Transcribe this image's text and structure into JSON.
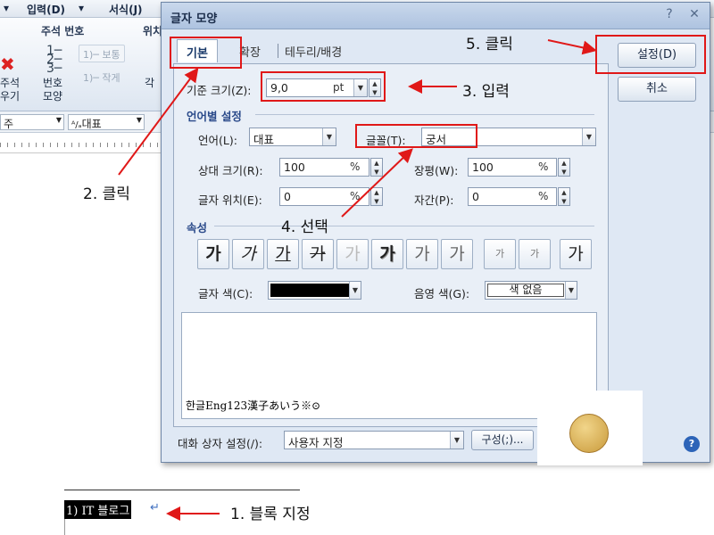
{
  "menu": {
    "input": "입력(D)",
    "format": "서식(J)"
  },
  "ribbon": {
    "group_annotation": "주석 번호",
    "group_position": "위치",
    "btn_normal": "1)─ 보통",
    "btn_small": "1)─ 작게",
    "label_number_shape_1": "번호",
    "label_number_shape_2": "모양",
    "label_delete_1": "주석",
    "label_delete_2": "우기",
    "label_each": "각"
  },
  "format_bar": {
    "style_value": "주",
    "font_value": "대표"
  },
  "document": {
    "text": "1) IT 블로그"
  },
  "annotations": {
    "step1": "1. 블록 지정",
    "step2": "2. 클릭",
    "step3": "3. 입력",
    "step4": "4. 선택",
    "step5": "5. 클릭"
  },
  "dialog": {
    "title": "글자 모양",
    "help": "?",
    "close": "✕",
    "tabs": [
      "기본",
      "확장",
      "테두리/배경"
    ],
    "base_size_label": "기준 크기(Z):",
    "base_size_value": "9,0",
    "base_size_unit": "pt",
    "lang_section": "언어별 설정",
    "language_label": "언어(L):",
    "language_value": "대표",
    "font_label": "글꼴(T):",
    "font_value": "궁서",
    "rel_size_label": "상대 크기(R):",
    "rel_size_value": "100",
    "rel_size_unit": "%",
    "width_label": "장평(W):",
    "width_value": "100",
    "width_unit": "%",
    "position_label": "글자 위치(E):",
    "position_value": "0",
    "position_unit": "%",
    "spacing_label": "자간(P):",
    "spacing_value": "0",
    "spacing_unit": "%",
    "attr_section": "속성",
    "attr_buttons": [
      "가",
      "가",
      "가",
      "가",
      "가",
      "가",
      "가",
      "가",
      "가",
      "가",
      "가"
    ],
    "color_label": "글자 색(C):",
    "color_value": "#000000",
    "shade_label": "음영 색(G):",
    "shade_value": "색 없음",
    "preview_text": "한글Eng123漢子あいう※⊙",
    "dialog_setting_label": "대화 상자 설정(/):",
    "dialog_setting_value": "사용자 지정",
    "compose_button": "구성(;)...",
    "ok_button": "설정(D)",
    "cancel_button": "취소"
  },
  "colors": {
    "annotation_red": "#e01818",
    "dialog_bg": "#dfe8f4",
    "section_blue": "#2a4a8a"
  }
}
